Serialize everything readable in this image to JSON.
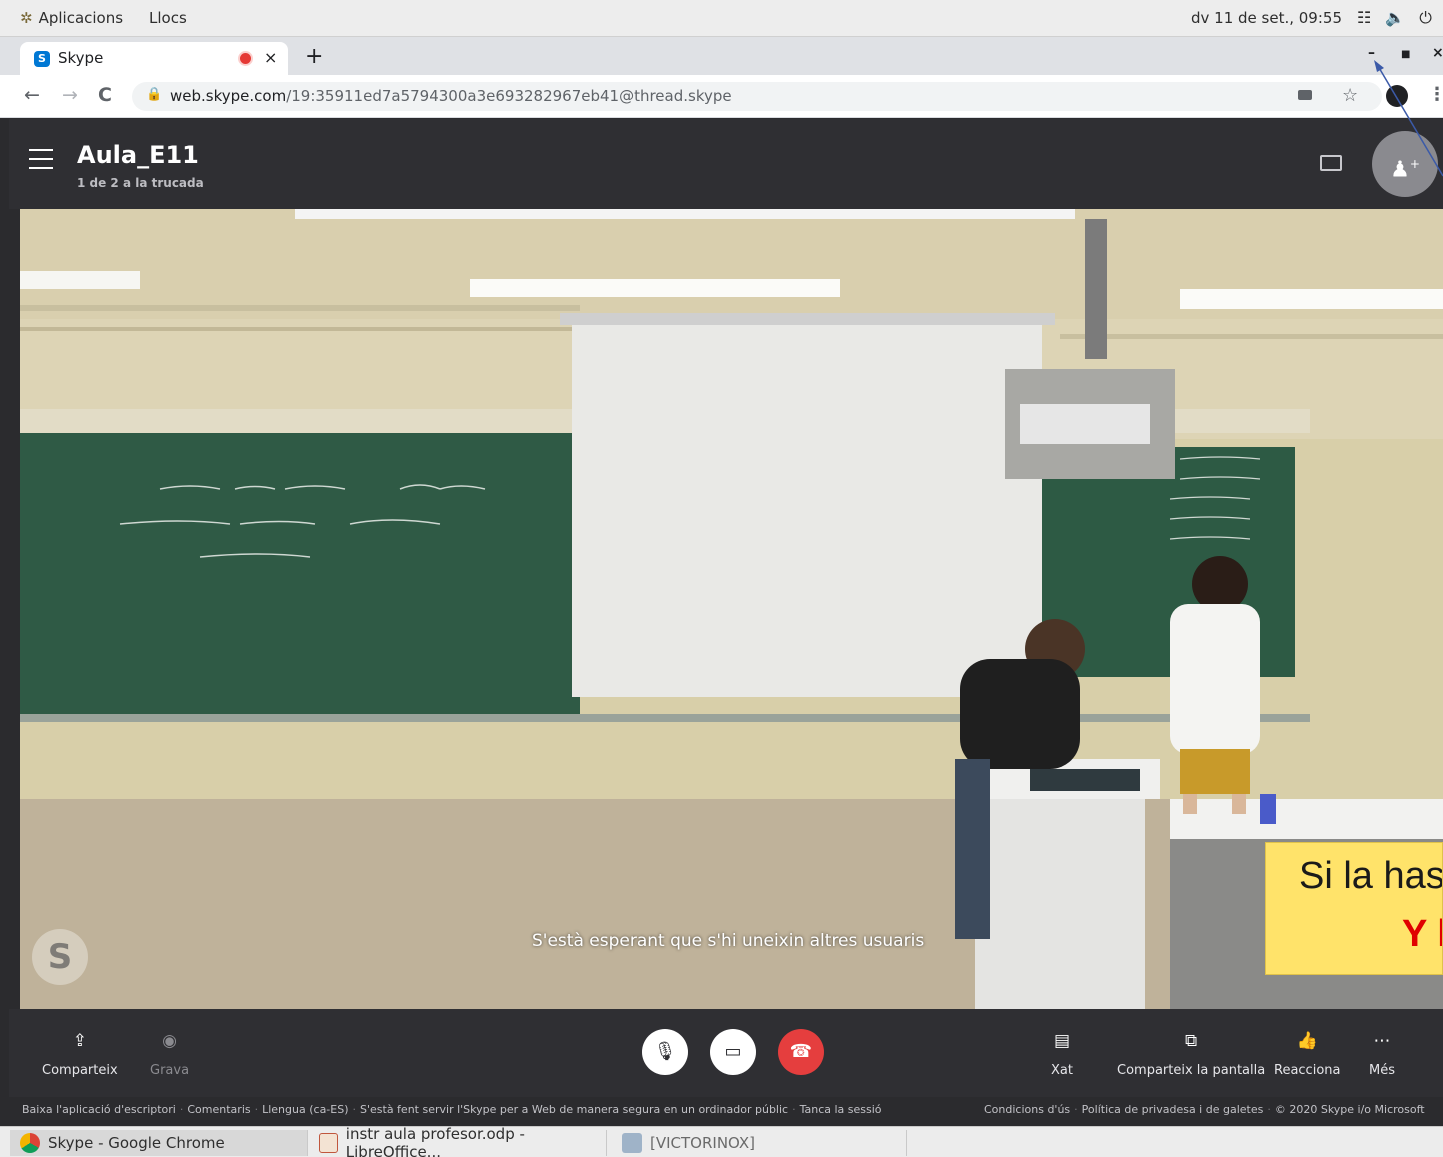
{
  "topbar": {
    "apps_label": "Aplicacions",
    "places_label": "Llocs",
    "clock": "dv 11 de set., 09:55"
  },
  "browser": {
    "tab_title": "Skype",
    "url_host": "web.skype.com",
    "url_path": "/19:35911ed7a5794300a3e693282967eb41@thread.skype"
  },
  "skype": {
    "room_title": "Aula_E11",
    "room_subtitle": "1 de 2 a la trucada",
    "waiting_text": "S'està esperant que s'hi uneixin altres usuaris",
    "controls": {
      "share": "Comparteix",
      "record": "Grava",
      "chat": "Xat",
      "share_screen": "Comparteix la pantalla",
      "react": "Reacciona",
      "more": "Més"
    },
    "footer_left": [
      "Baixa l'aplicació d'escriptori",
      "Comentaris",
      "Llengua (ca-ES)",
      "S'està fent servir l'Skype per a Web de manera segura en un ordinador públic",
      "Tanca la sessió"
    ],
    "footer_right": [
      "Condicions d'ús",
      "Política de privadesa i de galetes",
      "© 2020 Skype i/o Microsoft"
    ]
  },
  "overlay": {
    "line1": "Si la has",
    "line2": "Y l"
  },
  "taskbar": {
    "items": [
      "Skype - Google Chrome",
      "instr aula profesor.odp - LibreOffice...",
      "[VICTORINOX]"
    ]
  },
  "colors": {
    "skype_dark": "#2f2f33",
    "hangup_red": "#e53e3e",
    "overlay_yellow": "#ffe36a",
    "overlay_red": "#e00000",
    "chalkboard": "#2f5a45"
  }
}
